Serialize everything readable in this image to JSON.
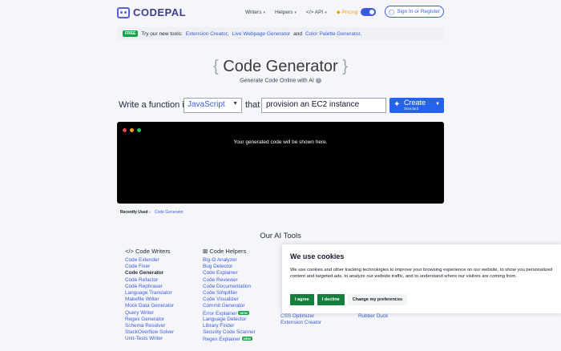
{
  "header": {
    "logo": "CODEPAL",
    "nav": [
      "Writers",
      "Helpers",
      "API"
    ],
    "pricing": "Pricing",
    "signin": "Sign In or Register"
  },
  "announce": {
    "badge": "FREE",
    "lead": "Try our new tools:",
    "link1": "Extension Creator",
    "sep1": ",",
    "link2": "Live Webpage Generator",
    "sep2": "and",
    "link3": "Color Palette Generator",
    "tail": "."
  },
  "hero": {
    "title": "Code Generator",
    "brace_open": "{",
    "brace_close": "}",
    "subtitle": "Generate Code Online with AI"
  },
  "prompt_row": {
    "write_label": "Write a function in",
    "language": "JavaScript",
    "that_label": "that",
    "prompt_value": "provision an EC2 instance",
    "create_label": "Create",
    "create_sub": "Standard"
  },
  "terminal": {
    "placeholder": "Your generated code will be shown here."
  },
  "recent": {
    "label": "Recently Used",
    "item": "Code Generator"
  },
  "tools": {
    "title": "Our AI Tools",
    "writers_title": "Code Writers",
    "writers": [
      "Code Extender",
      "Code Fixer",
      "Code Generator",
      "Code Refactor",
      "Code Rephraser",
      "Language Translator",
      "Makefile Writer",
      "Mock Data Generator",
      "Query Writer",
      "Regex Generator",
      "Schema Resolver",
      "StackOverflow Solver",
      "Unit-Tests Writer"
    ],
    "helpers_title": "Code Helpers",
    "helpers": [
      "Big-O Analyzer",
      "Bug Detector",
      "Code Explainer",
      "Code Reviewer",
      "Code Documentation",
      "Code Simplifier",
      "Code Visualizer",
      "Commit Generator",
      "Error Explainer",
      "Language Detector",
      "Library Finder",
      "Security Code Scanner",
      "Regex Explainer"
    ],
    "new_badge": "NEW",
    "col3": [
      "CSS Optimizer",
      "Extension Creator"
    ],
    "col4": [
      "Rubber Duck"
    ]
  },
  "cookie": {
    "title": "We use cookies",
    "text": "We use cookies and other tracking technologies to improve your browsing experience on our website, to show you personalized content and targeted ads, to analyze our website traffic, and to understand where our visitors are coming from.",
    "agree": "I agree",
    "decline": "I decline",
    "prefs": "Change my preferences"
  },
  "colors": {
    "accent": "#3b5bdb",
    "green": "#15803d",
    "create": "#2563eb"
  }
}
